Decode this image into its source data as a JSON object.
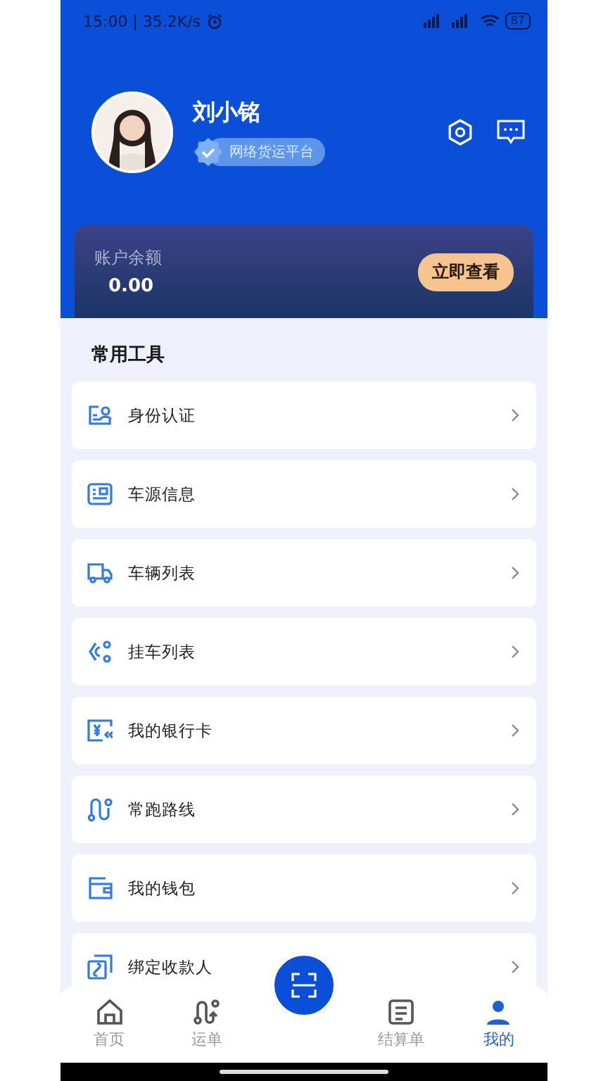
{
  "status_bar": {
    "time": "15:00 | 35.2K/s",
    "battery": "87"
  },
  "profile": {
    "name": "刘小铭",
    "badge": "网络货运平台"
  },
  "balance": {
    "label": "账户余额",
    "amount": "0.00",
    "button": "立即查看"
  },
  "tools": {
    "title": "常用工具",
    "items": [
      {
        "label": "身份认证"
      },
      {
        "label": "车源信息"
      },
      {
        "label": "车辆列表"
      },
      {
        "label": "挂车列表"
      },
      {
        "label": "我的银行卡"
      },
      {
        "label": "常跑路线"
      },
      {
        "label": "我的钱包"
      },
      {
        "label": "绑定收款人"
      }
    ]
  },
  "nav": [
    {
      "label": "首页",
      "selected": false
    },
    {
      "label": "运单",
      "selected": false
    },
    {
      "label": "结算单",
      "selected": false
    },
    {
      "label": "我的",
      "selected": true
    }
  ]
}
